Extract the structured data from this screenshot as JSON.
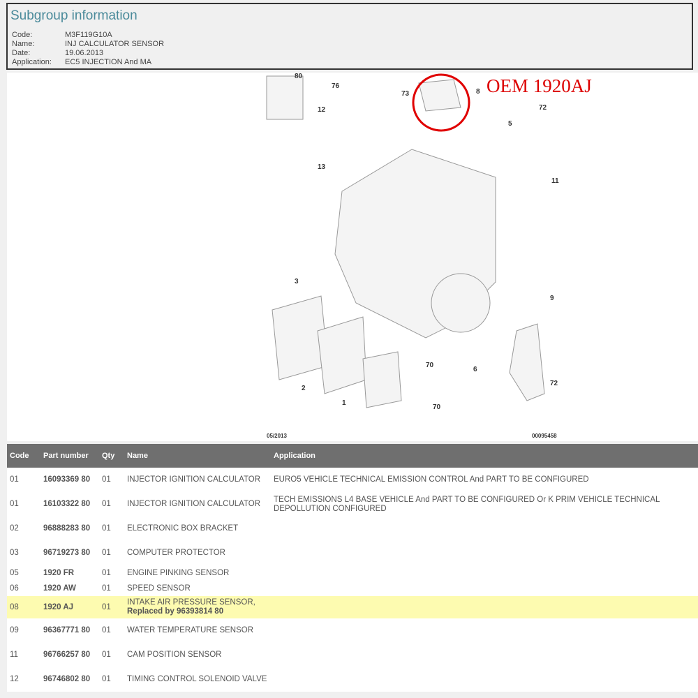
{
  "header": {
    "title": "Subgroup information",
    "fields": [
      {
        "label": "Code:",
        "value": "M3F119G10A"
      },
      {
        "label": "Name:",
        "value": "INJ CALCULATOR SENSOR"
      },
      {
        "label": "Date:",
        "value": "19.06.2013"
      },
      {
        "label": "Application:",
        "value": "EC5 INJECTION And MA"
      }
    ]
  },
  "diagram": {
    "annotation": "OEM 1920AJ",
    "date_label": "05/2013",
    "ref_label": "00095458",
    "callouts": [
      "80",
      "76",
      "12",
      "13",
      "73",
      "8",
      "72",
      "5",
      "11",
      "9",
      "3",
      "2",
      "1",
      "70",
      "70",
      "6",
      "72"
    ],
    "highlight_color": "#e00000"
  },
  "table": {
    "headers": [
      "Code",
      "Part number",
      "Qty",
      "Name",
      "Application"
    ],
    "highlight_color": "#fdfbb0",
    "rows": [
      {
        "code": "01",
        "part": "16093369 80",
        "qty": "01",
        "name": "INJECTOR IGNITION CALCULATOR",
        "app": "EURO5 VEHICLE TECHNICAL EMISSION CONTROL And PART TO BE CONFIGURED"
      },
      {
        "code": "01",
        "part": "16103322 80",
        "qty": "01",
        "name": "INJECTOR IGNITION CALCULATOR",
        "app": "TECH EMISSIONS L4 BASE VEHICLE And PART TO BE CONFIGURED Or K PRIM VEHICLE TECHNICAL DEPOLLUTION CONFIGURED"
      },
      {
        "code": "02",
        "part": "96888283 80",
        "qty": "01",
        "name": "ELECTRONIC BOX BRACKET",
        "app": ""
      },
      {
        "code": "03",
        "part": "96719273 80",
        "qty": "01",
        "name": "COMPUTER PROTECTOR",
        "app": ""
      },
      {
        "code": "05",
        "part": "1920 FR",
        "qty": "01",
        "name": "ENGINE PINKING SENSOR",
        "app": ""
      },
      {
        "code": "06",
        "part": "1920 AW",
        "qty": "01",
        "name": "SPEED SENSOR",
        "app": ""
      },
      {
        "code": "08",
        "part": "1920 AJ",
        "qty": "01",
        "name": "INTAKE AIR PRESSURE SENSOR,",
        "name2": "Replaced by 96393814 80",
        "app": "",
        "highlighted": true
      },
      {
        "code": "09",
        "part": "96367771 80",
        "qty": "01",
        "name": "WATER TEMPERATURE SENSOR",
        "app": ""
      },
      {
        "code": "11",
        "part": "96766257 80",
        "qty": "01",
        "name": "CAM POSITION SENSOR",
        "app": ""
      },
      {
        "code": "12",
        "part": "96746802 80",
        "qty": "01",
        "name": "TIMING CONTROL SOLENOID VALVE",
        "app": ""
      }
    ]
  }
}
